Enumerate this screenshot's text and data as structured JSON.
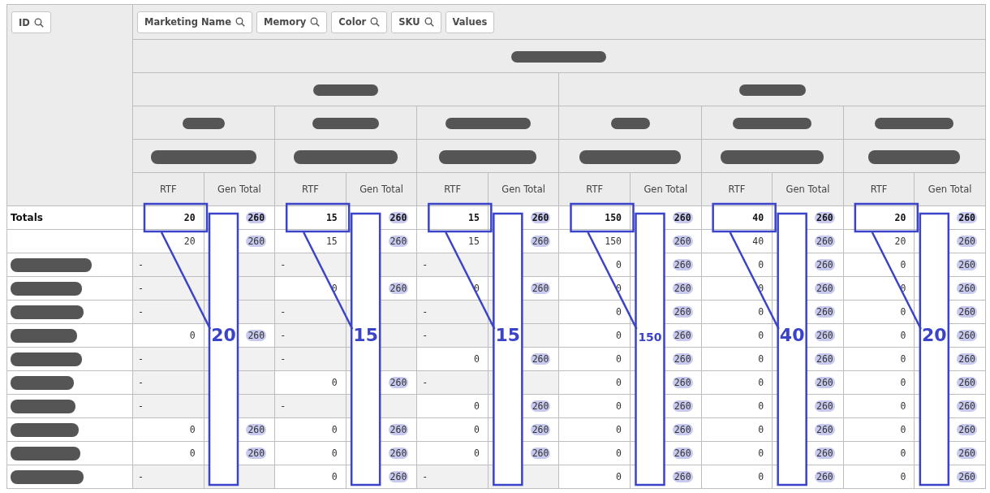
{
  "id_filter": {
    "label": "ID",
    "kind": "search"
  },
  "filters": [
    {
      "label": "Marketing Name",
      "kind": "search"
    },
    {
      "label": "Memory",
      "kind": "search"
    },
    {
      "label": "Color",
      "kind": "search"
    },
    {
      "label": "SKU",
      "kind": "search"
    },
    {
      "label": "Values",
      "kind": "plain"
    }
  ],
  "measure_headers": [
    "RTF",
    "Gen Total",
    "RTF",
    "Gen Total",
    "RTF",
    "Gen Total",
    "RTF",
    "Gen Total",
    "RTF",
    "Gen Total",
    "RTF",
    "Gen Total"
  ],
  "rows": [
    {
      "label": "Totals",
      "total": true,
      "redacted": false,
      "cells": [
        {
          "rtf": "20",
          "gen": "260"
        },
        {
          "rtf": "15",
          "gen": "260"
        },
        {
          "rtf": "15",
          "gen": "260"
        },
        {
          "rtf": "150",
          "gen": "260"
        },
        {
          "rtf": "40",
          "gen": "260"
        },
        {
          "rtf": "20",
          "gen": "260"
        }
      ]
    },
    {
      "total": false,
      "redacted": false,
      "cells": [
        {
          "rtf": "20",
          "gen": "260"
        },
        {
          "rtf": "15",
          "gen": "260"
        },
        {
          "rtf": "15",
          "gen": "260"
        },
        {
          "rtf": "150",
          "gen": "260"
        },
        {
          "rtf": "40",
          "gen": "260"
        },
        {
          "rtf": "20",
          "gen": "260"
        }
      ]
    },
    {
      "total": false,
      "redacted": true,
      "cells": [
        {
          "kind": "empty",
          "rtf": "-"
        },
        {
          "kind": "empty",
          "rtf": "-"
        },
        {
          "kind": "empty",
          "rtf": "-"
        },
        {
          "rtf": "0",
          "gen": "260"
        },
        {
          "rtf": "0",
          "gen": "260"
        },
        {
          "rtf": "0",
          "gen": "260"
        }
      ]
    },
    {
      "total": false,
      "redacted": true,
      "cells": [
        {
          "kind": "empty",
          "rtf": "-"
        },
        {
          "rtf": "0",
          "gen": "260"
        },
        {
          "rtf": "0",
          "gen": "260"
        },
        {
          "rtf": "0",
          "gen": "260"
        },
        {
          "rtf": "0",
          "gen": "260"
        },
        {
          "rtf": "0",
          "gen": "260"
        }
      ]
    },
    {
      "total": false,
      "redacted": true,
      "cells": [
        {
          "kind": "empty",
          "rtf": "-"
        },
        {
          "kind": "empty",
          "rtf": "-"
        },
        {
          "kind": "empty",
          "rtf": "-"
        },
        {
          "rtf": "0",
          "gen": "260"
        },
        {
          "rtf": "0",
          "gen": "260"
        },
        {
          "rtf": "0",
          "gen": "260"
        }
      ]
    },
    {
      "total": false,
      "redacted": true,
      "cells": [
        {
          "rtf": "0",
          "gen": "260"
        },
        {
          "kind": "empty",
          "rtf": "-"
        },
        {
          "kind": "empty",
          "rtf": "-"
        },
        {
          "rtf": "0",
          "gen": "260"
        },
        {
          "rtf": "0",
          "gen": "260"
        },
        {
          "rtf": "0",
          "gen": "260"
        }
      ]
    },
    {
      "total": false,
      "redacted": true,
      "cells": [
        {
          "kind": "empty",
          "rtf": "-"
        },
        {
          "kind": "empty",
          "rtf": "-"
        },
        {
          "rtf": "0",
          "gen": "260"
        },
        {
          "rtf": "0",
          "gen": "260"
        },
        {
          "rtf": "0",
          "gen": "260"
        },
        {
          "rtf": "0",
          "gen": "260"
        }
      ]
    },
    {
      "total": false,
      "redacted": true,
      "cells": [
        {
          "kind": "empty",
          "rtf": "-"
        },
        {
          "rtf": "0",
          "gen": "260"
        },
        {
          "kind": "empty",
          "rtf": "-"
        },
        {
          "rtf": "0",
          "gen": "260"
        },
        {
          "rtf": "0",
          "gen": "260"
        },
        {
          "rtf": "0",
          "gen": "260"
        }
      ]
    },
    {
      "total": false,
      "redacted": true,
      "cells": [
        {
          "kind": "empty",
          "rtf": "-"
        },
        {
          "kind": "empty",
          "rtf": "-"
        },
        {
          "rtf": "0",
          "gen": "260"
        },
        {
          "rtf": "0",
          "gen": "260"
        },
        {
          "rtf": "0",
          "gen": "260"
        },
        {
          "rtf": "0",
          "gen": "260"
        }
      ]
    },
    {
      "total": false,
      "redacted": true,
      "cells": [
        {
          "rtf": "0",
          "gen": "260"
        },
        {
          "rtf": "0",
          "gen": "260"
        },
        {
          "rtf": "0",
          "gen": "260"
        },
        {
          "rtf": "0",
          "gen": "260"
        },
        {
          "rtf": "0",
          "gen": "260"
        },
        {
          "rtf": "0",
          "gen": "260"
        }
      ]
    },
    {
      "total": false,
      "redacted": true,
      "cells": [
        {
          "rtf": "0",
          "gen": "260"
        },
        {
          "rtf": "0",
          "gen": "260"
        },
        {
          "rtf": "0",
          "gen": "260"
        },
        {
          "rtf": "0",
          "gen": "260"
        },
        {
          "rtf": "0",
          "gen": "260"
        },
        {
          "rtf": "0",
          "gen": "260"
        }
      ]
    },
    {
      "total": false,
      "redacted": true,
      "cells": [
        {
          "kind": "empty",
          "rtf": "-"
        },
        {
          "rtf": "0",
          "gen": "260"
        },
        {
          "kind": "empty",
          "rtf": "-"
        },
        {
          "rtf": "0",
          "gen": "260"
        },
        {
          "rtf": "0",
          "gen": "260"
        },
        {
          "rtf": "0",
          "gen": "260"
        }
      ]
    }
  ],
  "annotations": [
    {
      "label": "20"
    },
    {
      "label": "15"
    },
    {
      "label": "15"
    },
    {
      "label": "150"
    },
    {
      "label": "40"
    },
    {
      "label": "20"
    }
  ]
}
